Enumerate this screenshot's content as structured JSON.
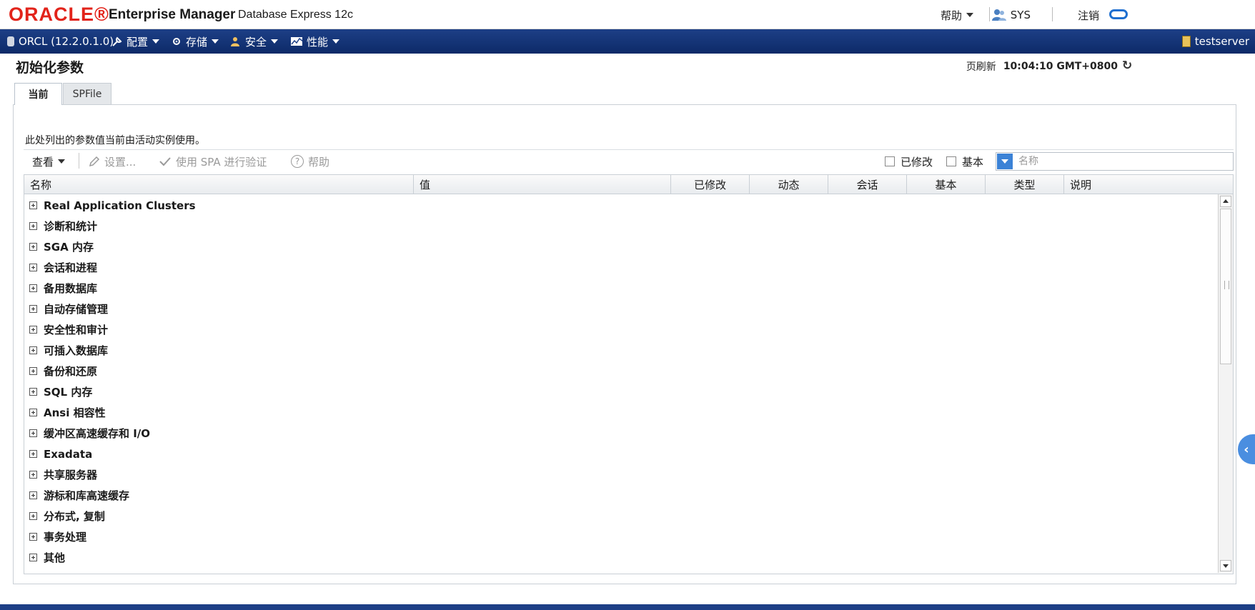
{
  "header": {
    "logo": "ORACLE®",
    "product": "Enterprise Manager",
    "subtitle": "Database Express 12c",
    "help": "帮助",
    "user": "SYS",
    "logout": "注销"
  },
  "nav": {
    "db": "ORCL (12.2.0.1.0)",
    "items": [
      "配置",
      "存储",
      "安全",
      "性能"
    ],
    "server": "testserver"
  },
  "page": {
    "title": "初始化参数",
    "refresh_label": "页刷新",
    "refresh_time": "10:04:10 GMT+0800"
  },
  "tabs": [
    "当前",
    "SPFile"
  ],
  "description": "此处列出的参数值当前由活动实例使用。",
  "toolbar": {
    "view": "查看",
    "set": "设置...",
    "validate": "使用 SPA 进行验证",
    "help": "帮助",
    "modified": "已修改",
    "basic": "基本",
    "filter_placeholder": "名称"
  },
  "table": {
    "columns": [
      "名称",
      "值",
      "已修改",
      "动态",
      "会话",
      "基本",
      "类型",
      "说明"
    ],
    "rows": [
      "Real Application Clusters",
      "诊断和统计",
      "SGA 内存",
      "会话和进程",
      "备用数据库",
      "自动存储管理",
      "安全性和审计",
      "可插入数据库",
      "备份和还原",
      "SQL 内存",
      "Ansi 相容性",
      "缓冲区高速缓存和 I/O",
      "Exadata",
      "共享服务器",
      "游标和库高速缓存",
      "分布式, 复制",
      "事务处理",
      "其他"
    ]
  },
  "colors": {
    "oracle_red": "#e2231a",
    "nav_blue": "#1d3f86",
    "accent_blue": "#3b82d6"
  }
}
